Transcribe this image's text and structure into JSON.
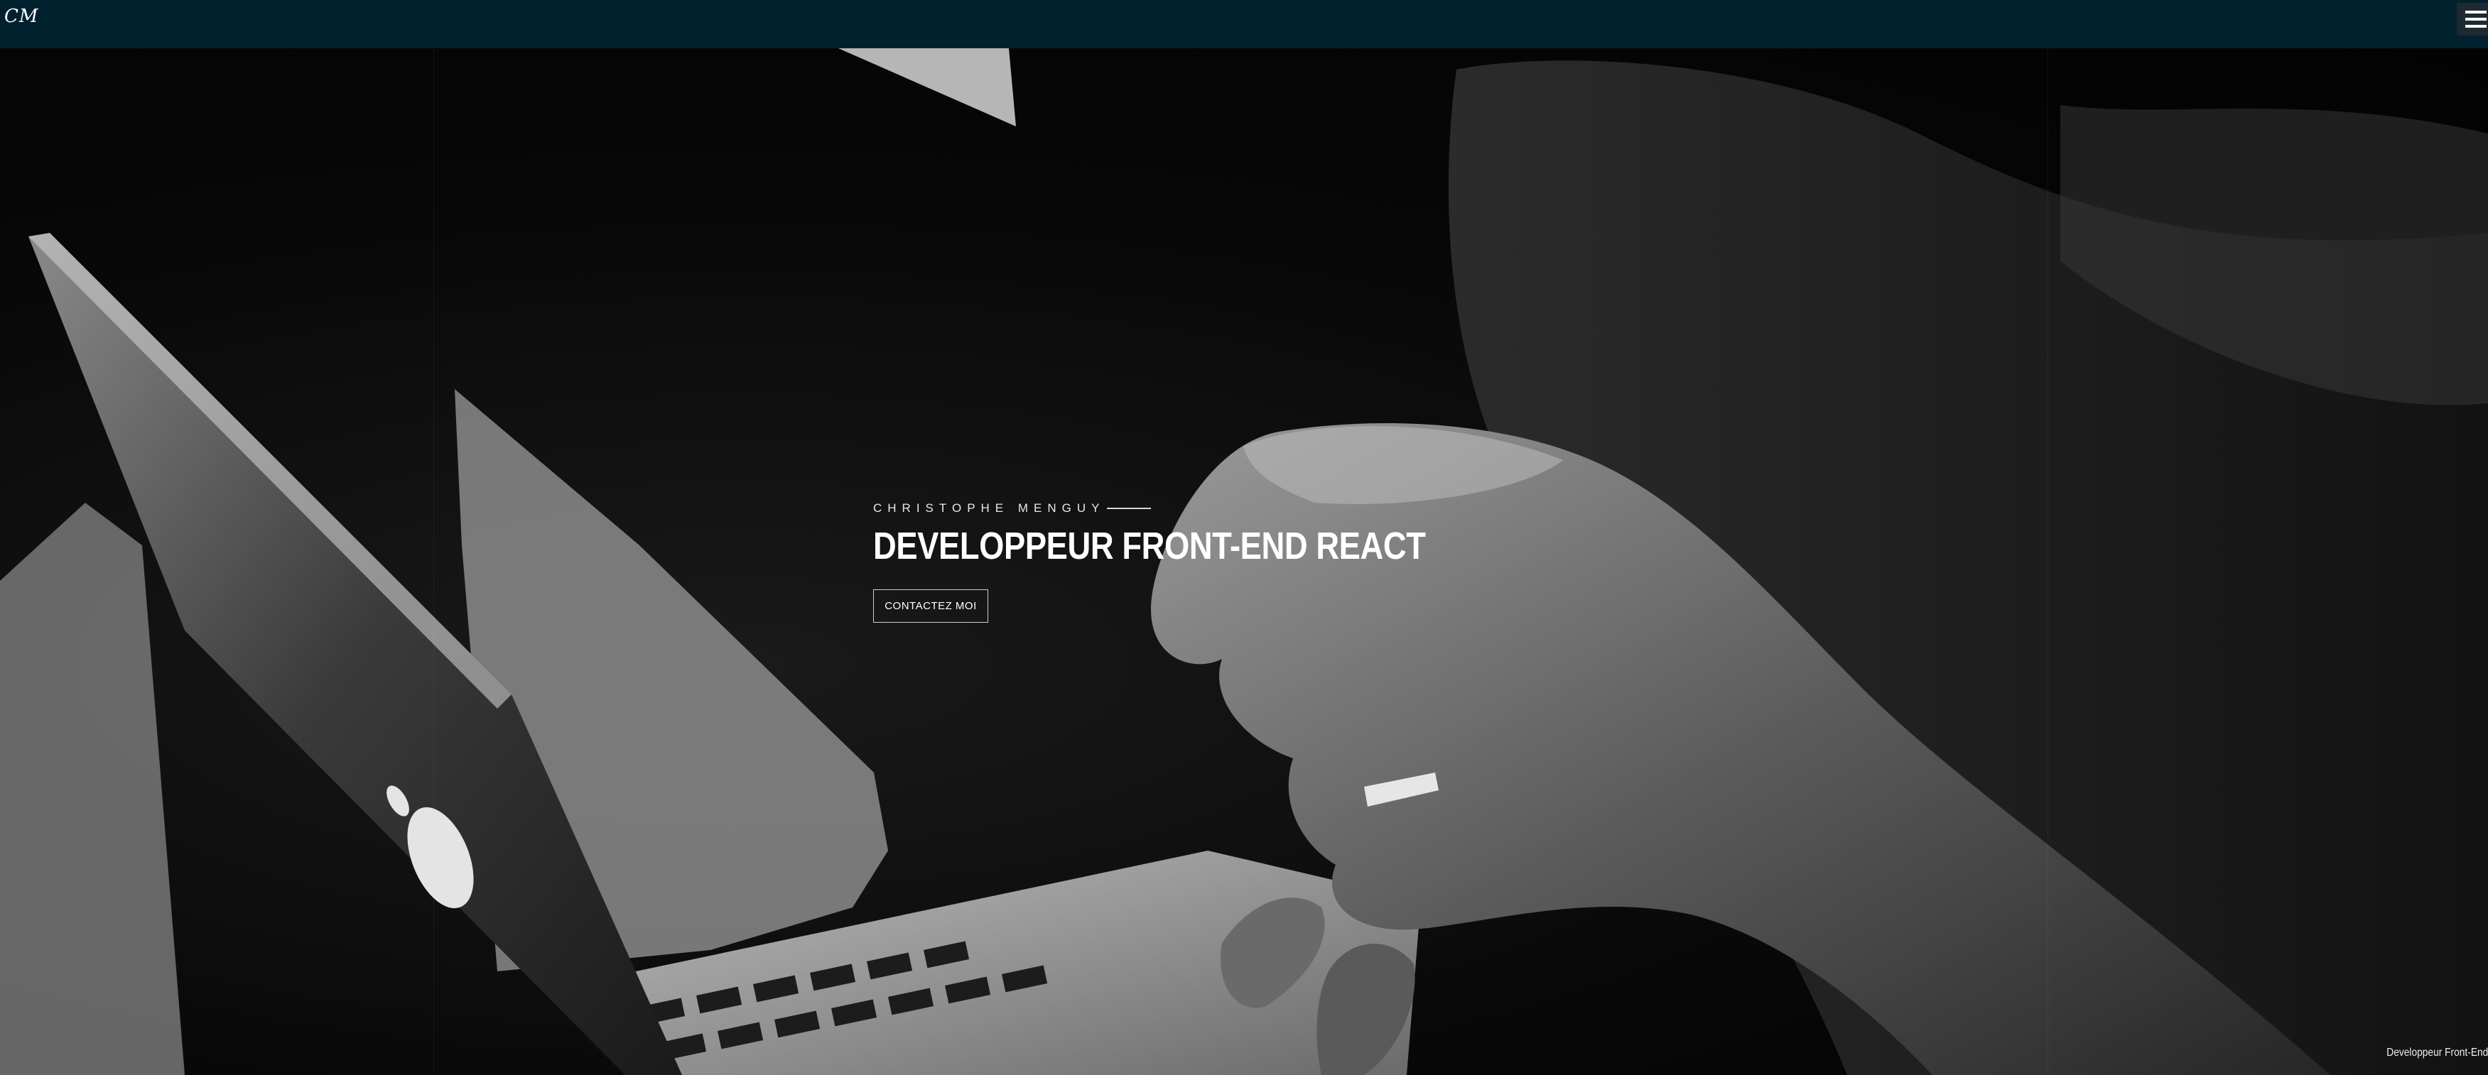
{
  "header": {
    "logo_text": "CM",
    "menu_icon": "hamburger-menu-icon",
    "background_color": "#02212f"
  },
  "hero": {
    "background_image": "black-and-white photo of hands over a laptop keyboard",
    "eyebrow": "CHRISTOPHE MENGUY",
    "headline": "DEVELOPPEUR FRONT-END REACT",
    "cta_label": "CONTACTEZ MOI"
  },
  "footer": {
    "tagline": "Developpeur Front-End"
  }
}
